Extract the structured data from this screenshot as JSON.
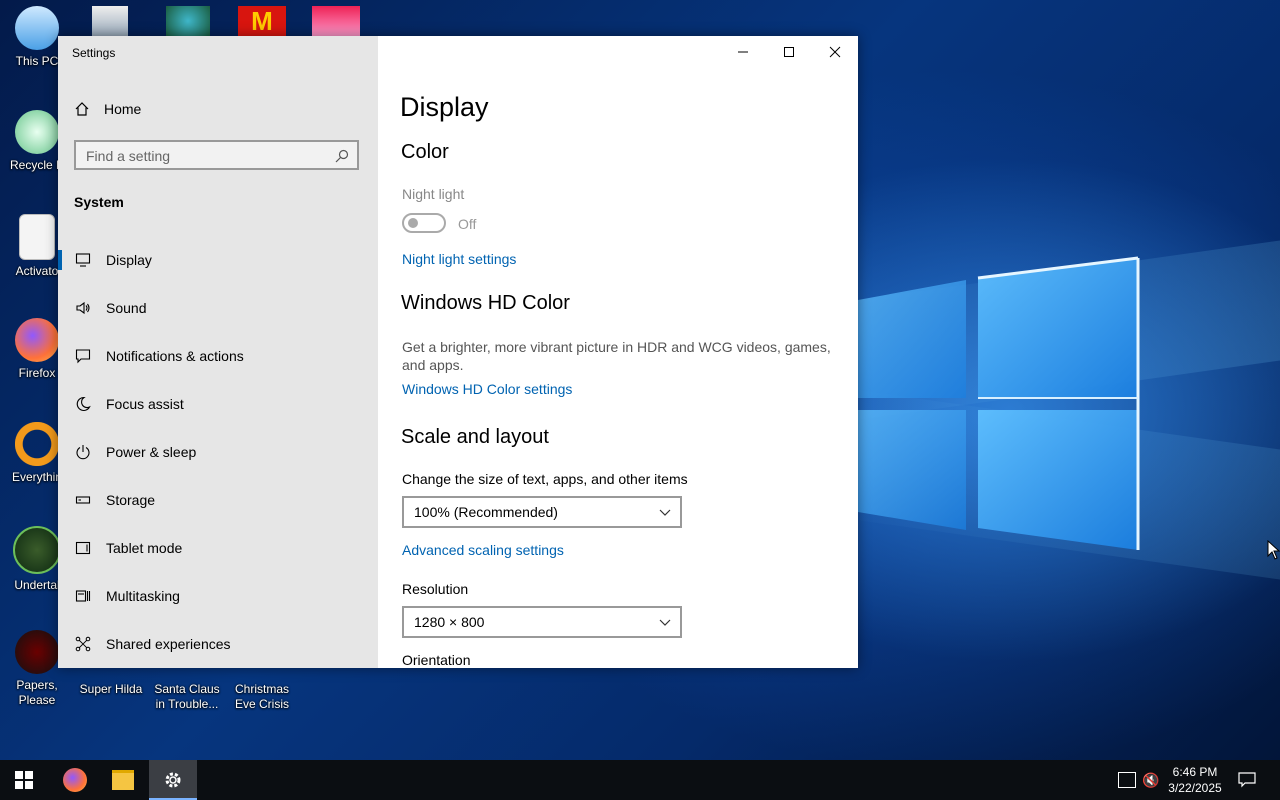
{
  "desktop": {
    "icons": [
      {
        "label": "This PC"
      },
      {
        "label": "Recycle B"
      },
      {
        "label": "Activato"
      },
      {
        "label": "Firefox"
      },
      {
        "label": "Everythin"
      },
      {
        "label": "Undertal"
      },
      {
        "label": "Papers, Please"
      },
      {
        "label": "Super Hilda"
      },
      {
        "label": "Santa Claus in Trouble..."
      },
      {
        "label": "Christmas Eve Crisis"
      }
    ]
  },
  "window": {
    "title": "Settings",
    "controls": {
      "minimize": "minimize-icon",
      "maximize": "maximize-icon",
      "close": "close-icon"
    }
  },
  "sidebar": {
    "home_label": "Home",
    "search_placeholder": "Find a setting",
    "section_title": "System",
    "items": [
      {
        "label": "Display",
        "icon": "monitor-icon",
        "active": true
      },
      {
        "label": "Sound",
        "icon": "speaker-icon"
      },
      {
        "label": "Notifications & actions",
        "icon": "notification-icon"
      },
      {
        "label": "Focus assist",
        "icon": "moon-icon"
      },
      {
        "label": "Power & sleep",
        "icon": "power-icon"
      },
      {
        "label": "Storage",
        "icon": "storage-icon"
      },
      {
        "label": "Tablet mode",
        "icon": "tablet-icon"
      },
      {
        "label": "Multitasking",
        "icon": "multitasking-icon"
      },
      {
        "label": "Shared experiences",
        "icon": "share-icon"
      }
    ]
  },
  "main": {
    "page_title": "Display",
    "color": {
      "heading": "Color",
      "night_light_label": "Night light",
      "night_light_state": "Off",
      "night_light_settings_link": "Night light settings"
    },
    "hdr": {
      "heading": "Windows HD Color",
      "description": "Get a brighter, more vibrant picture in HDR and WCG videos, games, and apps.",
      "link": "Windows HD Color settings"
    },
    "scale": {
      "heading": "Scale and layout",
      "size_label": "Change the size of text, apps, and other items",
      "size_value": "100% (Recommended)",
      "advanced_link": "Advanced scaling settings",
      "resolution_label": "Resolution",
      "resolution_value": "1280 × 800",
      "orientation_label": "Orientation"
    }
  },
  "taskbar": {
    "time": "6:46 PM",
    "date": "3/22/2025"
  },
  "colors": {
    "accent": "#0063b1",
    "sidebar_bg": "#e6e6e6"
  }
}
